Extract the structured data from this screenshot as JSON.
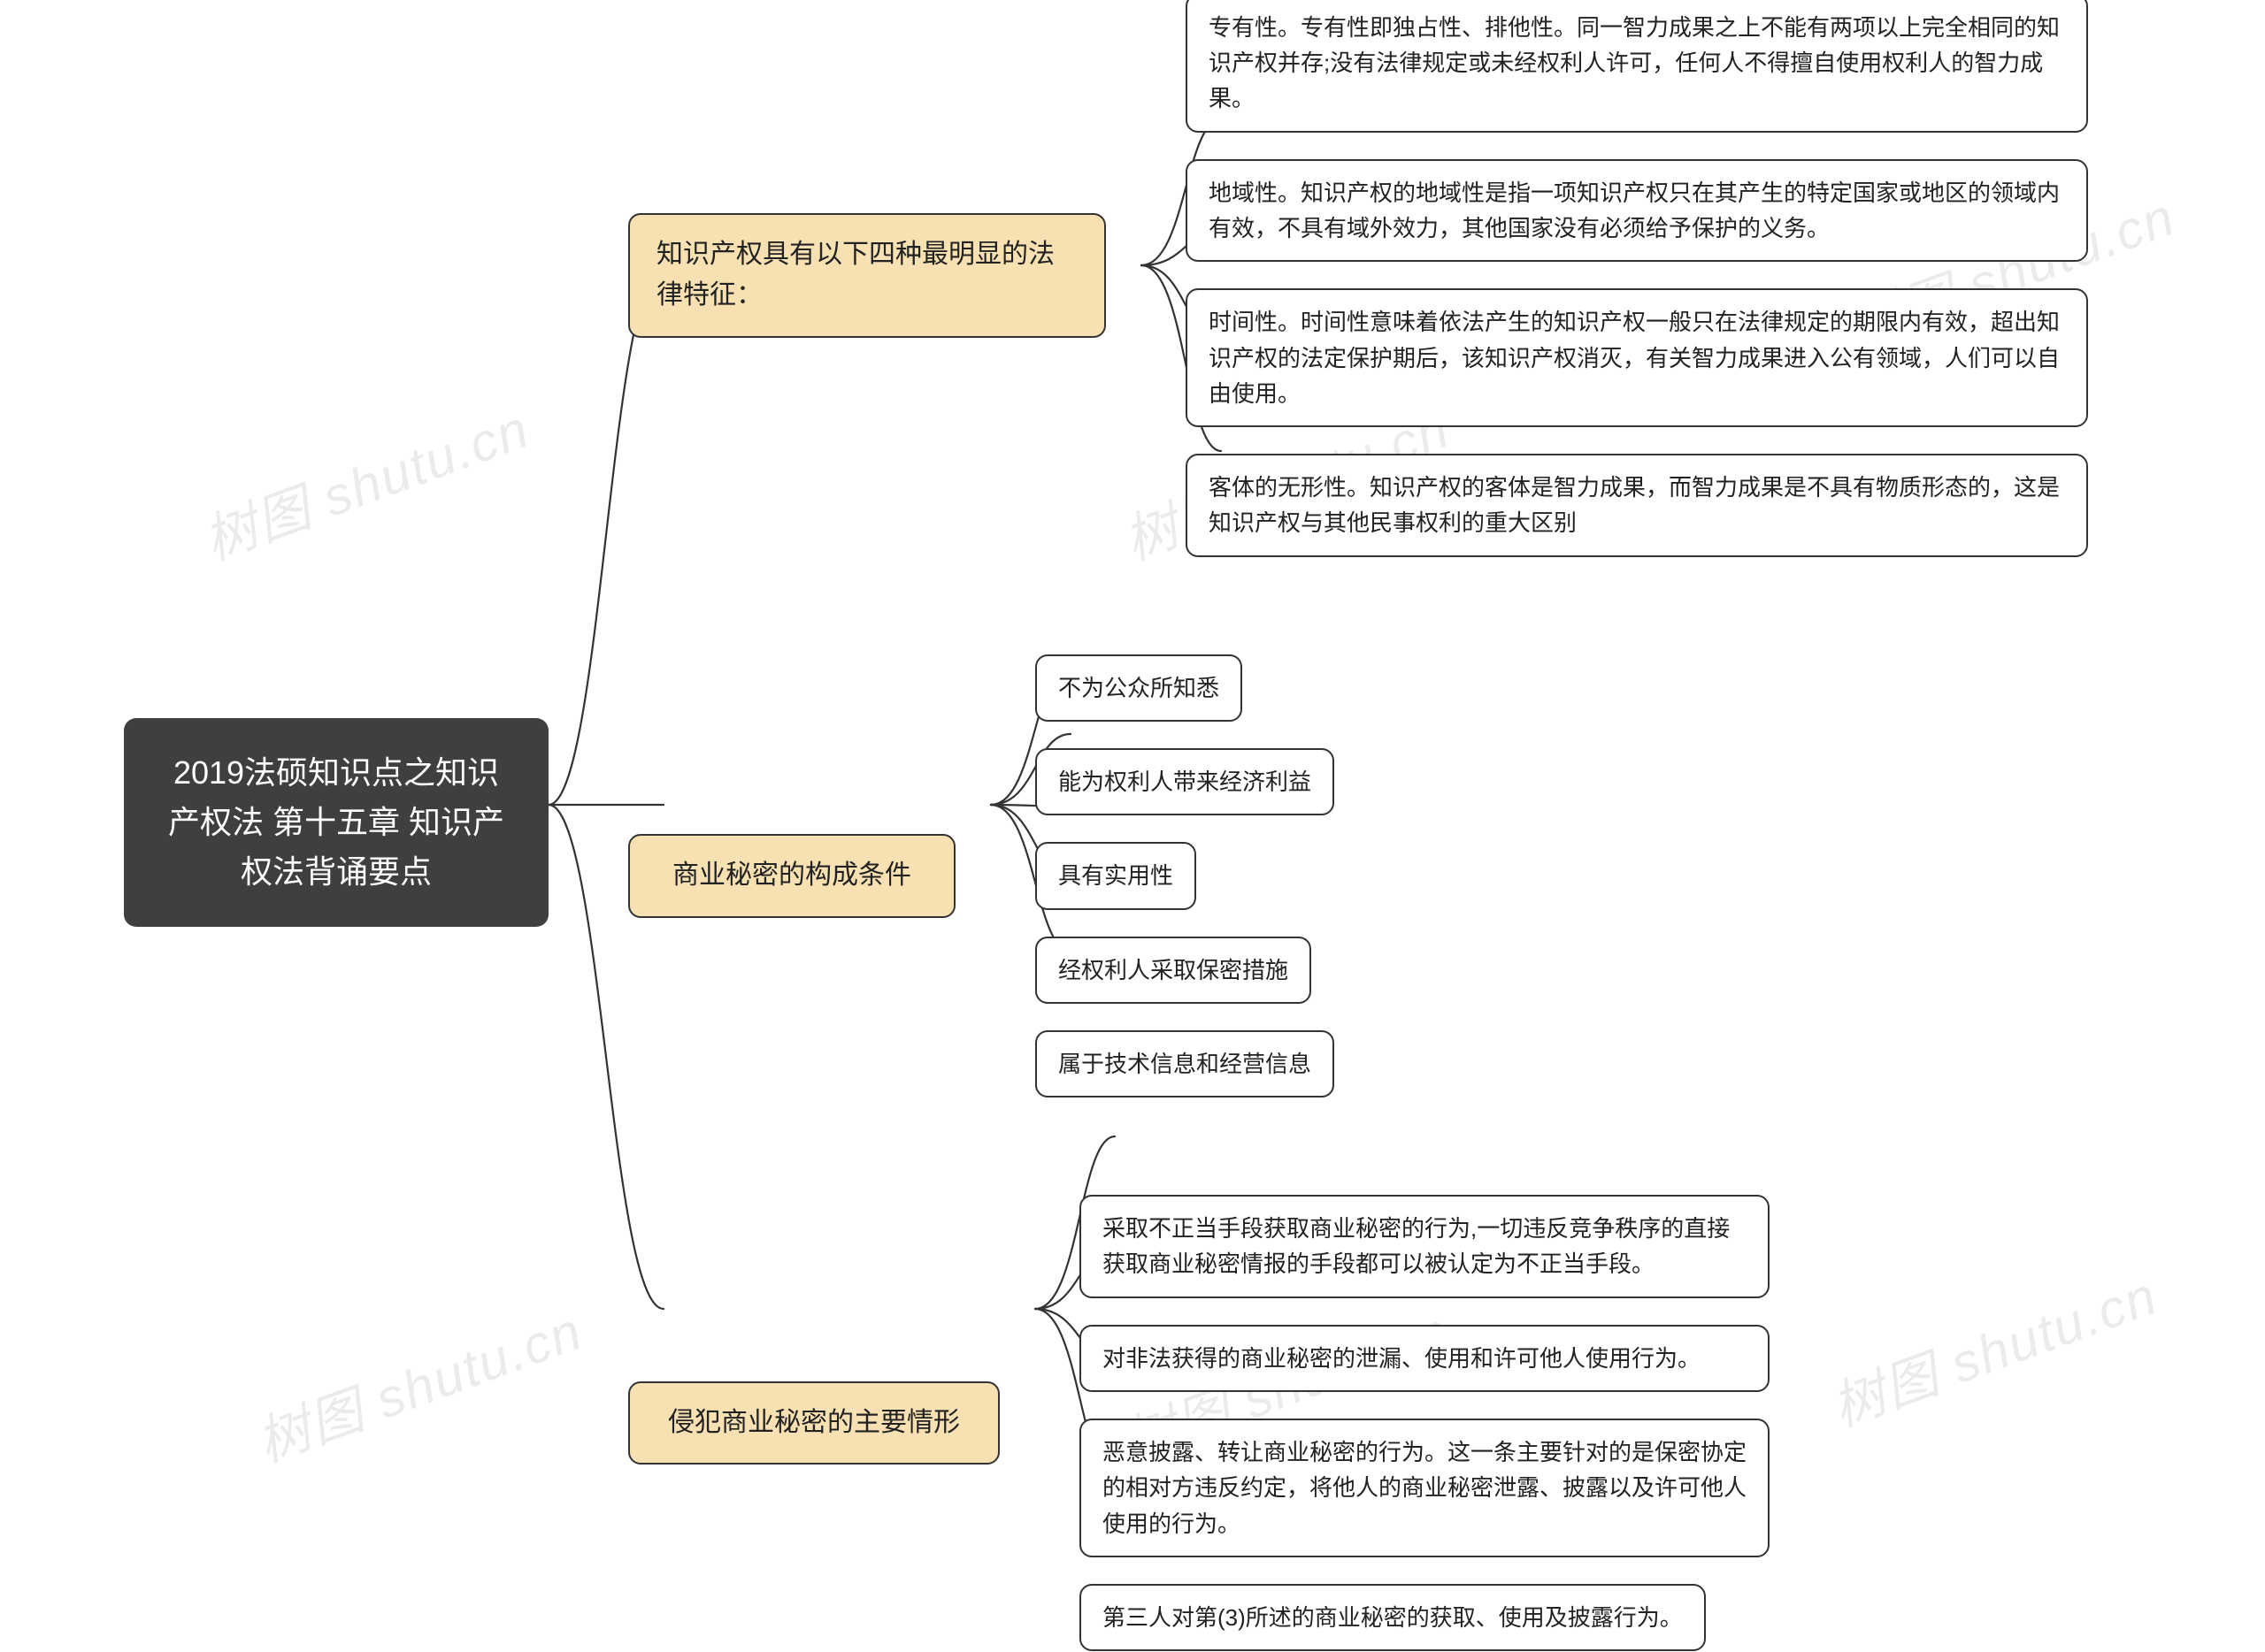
{
  "watermark": "树图 shutu.cn",
  "root": "2019法硕知识点之知识产权法 第十五章 知识产权法背诵要点",
  "branches": [
    {
      "label": "知识产权具有以下四种最明显的法律特征：",
      "children": [
        "专有性。专有性即独占性、排他性。同一智力成果之上不能有两项以上完全相同的知识产权并存;没有法律规定或未经权利人许可，任何人不得擅自使用权利人的智力成果。",
        "地域性。知识产权的地域性是指一项知识产权只在其产生的特定国家或地区的领域内有效，不具有域外效力，其他国家没有必须给予保护的义务。",
        "时间性。时间性意味着依法产生的知识产权一般只在法律规定的期限内有效，超出知识产权的法定保护期后，该知识产权消灭，有关智力成果进入公有领域，人们可以自由使用。",
        "客体的无形性。知识产权的客体是智力成果，而智力成果是不具有物质形态的，这是知识产权与其他民事权利的重大区别"
      ]
    },
    {
      "label": "商业秘密的构成条件",
      "children": [
        "不为公众所知悉",
        "能为权利人带来经济利益",
        "具有实用性",
        "经权利人采取保密措施",
        "属于技术信息和经营信息"
      ]
    },
    {
      "label": "侵犯商业秘密的主要情形",
      "children": [
        "采取不正当手段获取商业秘密的行为,一切违反竞争秩序的直接获取商业秘密情报的手段都可以被认定为不正当手段。",
        "对非法获得的商业秘密的泄漏、使用和许可他人使用行为。",
        "恶意披露、转让商业秘密的行为。这一条主要针对的是保密协定的相对方违反约定，将他人的商业秘密泄露、披露以及许可他人使用的行为。",
        "第三人对第(3)所述的商业秘密的获取、使用及披露行为。"
      ]
    }
  ]
}
